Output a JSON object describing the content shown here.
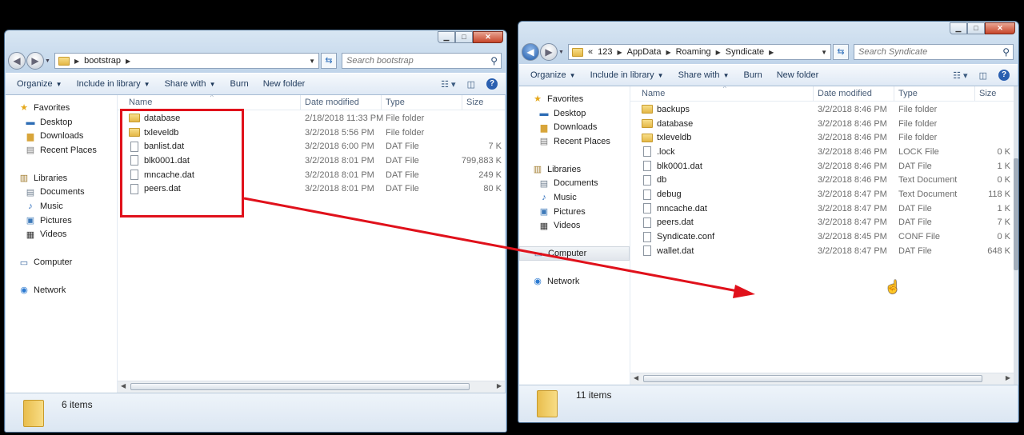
{
  "toolbar": {
    "organize": "Organize",
    "include": "Include in library",
    "share": "Share with",
    "burn": "Burn",
    "newfolder": "New folder"
  },
  "columns": {
    "name": "Name",
    "date": "Date modified",
    "type": "Type",
    "size": "Size"
  },
  "nav": {
    "favorites": "Favorites",
    "desktop": "Desktop",
    "downloads": "Downloads",
    "recent": "Recent Places",
    "libraries": "Libraries",
    "documents": "Documents",
    "music": "Music",
    "pictures": "Pictures",
    "videos": "Videos",
    "computer": "Computer",
    "network": "Network"
  },
  "left": {
    "path": [
      "bootstrap"
    ],
    "search_placeholder": "Search bootstrap",
    "status": "6 items",
    "files": [
      {
        "name": "database",
        "date": "2/18/2018 11:33 PM",
        "type": "File folder",
        "size": "",
        "folder": true
      },
      {
        "name": "txleveldb",
        "date": "3/2/2018 5:56 PM",
        "type": "File folder",
        "size": "",
        "folder": true
      },
      {
        "name": "banlist.dat",
        "date": "3/2/2018 6:00 PM",
        "type": "DAT File",
        "size": "7 K",
        "folder": false
      },
      {
        "name": "blk0001.dat",
        "date": "3/2/2018 8:01 PM",
        "type": "DAT File",
        "size": "799,883 K",
        "folder": false
      },
      {
        "name": "mncache.dat",
        "date": "3/2/2018 8:01 PM",
        "type": "DAT File",
        "size": "249 K",
        "folder": false
      },
      {
        "name": "peers.dat",
        "date": "3/2/2018 8:01 PM",
        "type": "DAT File",
        "size": "80 K",
        "folder": false
      }
    ]
  },
  "right": {
    "path_prefix": "«",
    "path": [
      "123",
      "AppData",
      "Roaming",
      "Syndicate"
    ],
    "search_placeholder": "Search Syndicate",
    "status": "11 items",
    "files": [
      {
        "name": "backups",
        "date": "3/2/2018 8:46 PM",
        "type": "File folder",
        "size": "",
        "folder": true
      },
      {
        "name": "database",
        "date": "3/2/2018 8:46 PM",
        "type": "File folder",
        "size": "",
        "folder": true
      },
      {
        "name": "txleveldb",
        "date": "3/2/2018 8:46 PM",
        "type": "File folder",
        "size": "",
        "folder": true
      },
      {
        "name": ".lock",
        "date": "3/2/2018 8:46 PM",
        "type": "LOCK File",
        "size": "0 K",
        "folder": false
      },
      {
        "name": "blk0001.dat",
        "date": "3/2/2018 8:46 PM",
        "type": "DAT File",
        "size": "1 K",
        "folder": false
      },
      {
        "name": "db",
        "date": "3/2/2018 8:46 PM",
        "type": "Text Document",
        "size": "0 K",
        "folder": false
      },
      {
        "name": "debug",
        "date": "3/2/2018 8:47 PM",
        "type": "Text Document",
        "size": "118 K",
        "folder": false
      },
      {
        "name": "mncache.dat",
        "date": "3/2/2018 8:47 PM",
        "type": "DAT File",
        "size": "1 K",
        "folder": false
      },
      {
        "name": "peers.dat",
        "date": "3/2/2018 8:47 PM",
        "type": "DAT File",
        "size": "7 K",
        "folder": false
      },
      {
        "name": "Syndicate.conf",
        "date": "3/2/2018 8:45 PM",
        "type": "CONF File",
        "size": "0 K",
        "folder": false
      },
      {
        "name": "wallet.dat",
        "date": "3/2/2018 8:47 PM",
        "type": "DAT File",
        "size": "648 K",
        "folder": false
      }
    ]
  },
  "colors": {
    "highlight": "#e0111b",
    "arrow": "#e0111b"
  }
}
